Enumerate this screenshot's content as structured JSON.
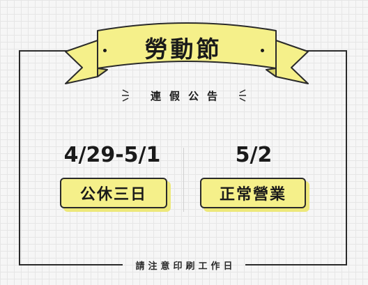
{
  "banner": {
    "title": "勞動節"
  },
  "subtitle": "連假公告",
  "holiday": {
    "date": "4/29-5/1",
    "status": "公休三日"
  },
  "open_day": {
    "date": "5/2",
    "status": "正常營業"
  },
  "footer": "請注意印刷工作日",
  "colors": {
    "accent_yellow": "#f5f08a",
    "accent_shadow": "#ede87a",
    "ink": "#2a2a2a",
    "background": "#f6f6f6",
    "grid": "#e6e6e6"
  },
  "icons": {
    "sparkle_left": "sparkle-lines-icon",
    "sparkle_right": "sparkle-lines-icon"
  }
}
